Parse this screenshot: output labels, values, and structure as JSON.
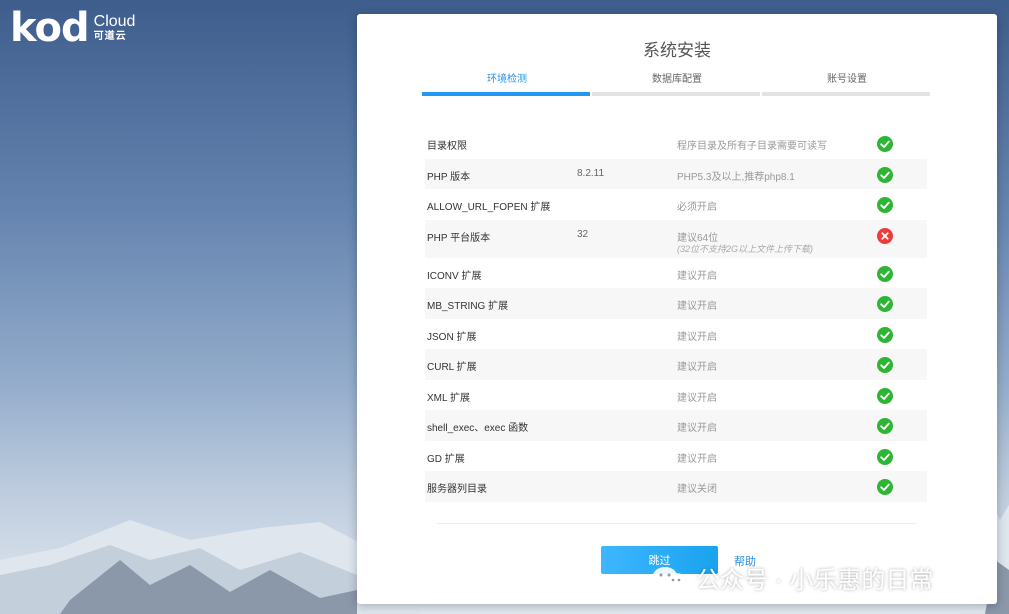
{
  "brand": {
    "logo": "kod",
    "product": "Cloud",
    "product_cn": "可道云"
  },
  "panel": {
    "title": "系统安装",
    "tabs": [
      {
        "label": "环境检测",
        "active": true
      },
      {
        "label": "数据库配置",
        "active": false
      },
      {
        "label": "账号设置",
        "active": false
      }
    ],
    "checks": [
      {
        "name": "目录权限",
        "value": "",
        "desc": "程序目录及所有子目录需要可读写",
        "note": "",
        "status": "ok"
      },
      {
        "name": "PHP 版本",
        "value": "8.2.11",
        "desc": "PHP5.3及以上,推荐php8.1",
        "note": "",
        "status": "ok"
      },
      {
        "name": "ALLOW_URL_FOPEN 扩展",
        "value": "",
        "desc": "必须开启",
        "note": "",
        "status": "ok"
      },
      {
        "name": "PHP 平台版本",
        "value": "32",
        "desc": "建议64位",
        "note": "(32位不支持2G以上文件上传下载)",
        "status": "fail"
      },
      {
        "name": "ICONV 扩展",
        "value": "",
        "desc": "建议开启",
        "note": "",
        "status": "ok"
      },
      {
        "name": "MB_STRING 扩展",
        "value": "",
        "desc": "建议开启",
        "note": "",
        "status": "ok"
      },
      {
        "name": "JSON 扩展",
        "value": "",
        "desc": "建议开启",
        "note": "",
        "status": "ok"
      },
      {
        "name": "CURL 扩展",
        "value": "",
        "desc": "建议开启",
        "note": "",
        "status": "ok"
      },
      {
        "name": "XML 扩展",
        "value": "",
        "desc": "建议开启",
        "note": "",
        "status": "ok"
      },
      {
        "name": "shell_exec、exec 函数",
        "value": "",
        "desc": "建议开启",
        "note": "",
        "status": "ok"
      },
      {
        "name": "GD 扩展",
        "value": "",
        "desc": "建议开启",
        "note": "",
        "status": "ok"
      },
      {
        "name": "服务器列目录",
        "value": "",
        "desc": "建议关闭",
        "note": "",
        "status": "ok"
      }
    ],
    "skip_label": "跳过",
    "help_label": "帮助"
  },
  "watermark": {
    "text": "公众号 · 小乐惠的日常",
    "icon": "wechat-icon"
  },
  "colors": {
    "accent": "#2196f3",
    "ok": "#2db533",
    "fail": "#ee3b3b"
  }
}
